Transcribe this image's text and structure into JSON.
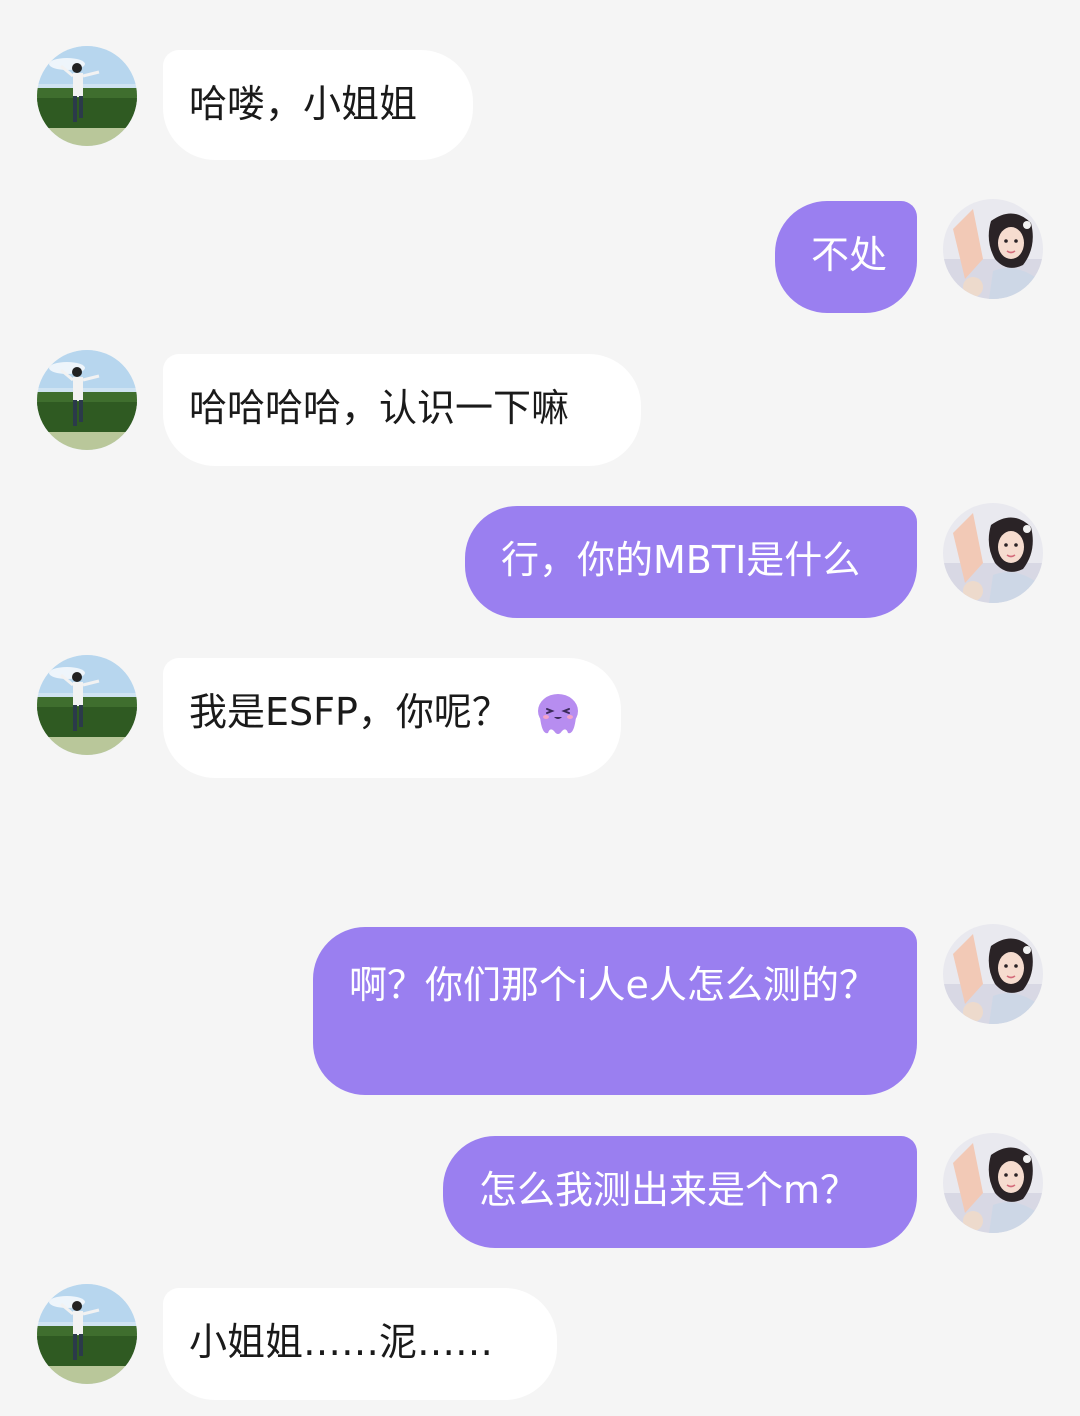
{
  "colors": {
    "background": "#f5f5f5",
    "incoming_bubble": "#ffffff",
    "outgoing_bubble": "#9a7ff0",
    "outgoing_text": "#ffffff",
    "incoming_text": "#1a1a1a"
  },
  "messages": [
    {
      "sender": "other",
      "text": "哈喽，小姐姐"
    },
    {
      "sender": "me",
      "text": "不处"
    },
    {
      "sender": "other",
      "text": "哈哈哈哈，认识一下嘛"
    },
    {
      "sender": "me",
      "text": "行，你的MBTI是什么"
    },
    {
      "sender": "other",
      "text": "我是ESFP，你呢？",
      "emoji": "purple-octopus-emoji"
    },
    {
      "sender": "me",
      "text": "啊？你们那个i人e人怎么测的？"
    },
    {
      "sender": "me",
      "text": "怎么我测出来是个m？"
    },
    {
      "sender": "other",
      "text": "小姐姐……泥……"
    }
  ]
}
